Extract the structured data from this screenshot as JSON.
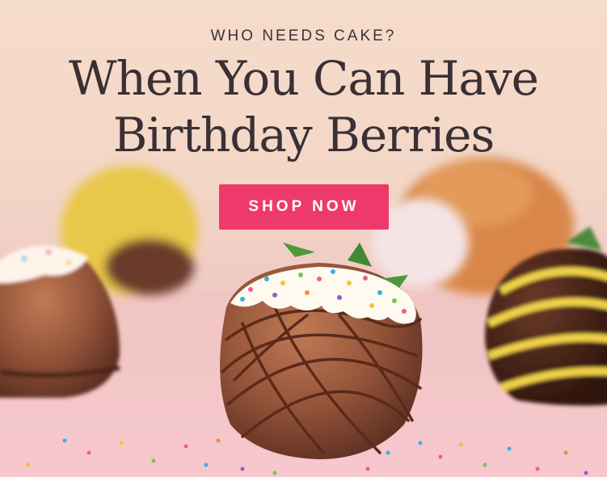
{
  "banner": {
    "eyebrow": "WHO NEEDS CAKE?",
    "title_line1": "When You Can Have",
    "title_line2": "Birthday Berries",
    "cta_label": "SHOP NOW"
  },
  "colors": {
    "background_top": "#f6dccb",
    "background_bottom": "#f2c6c9",
    "text": "#3a3034",
    "cta": "#ee3a6b",
    "milk_chocolate": "#8a4a2f",
    "dark_chocolate": "#4a2418",
    "yellow_drizzle": "#f2d24a",
    "white_icing": "#fffaf0"
  }
}
